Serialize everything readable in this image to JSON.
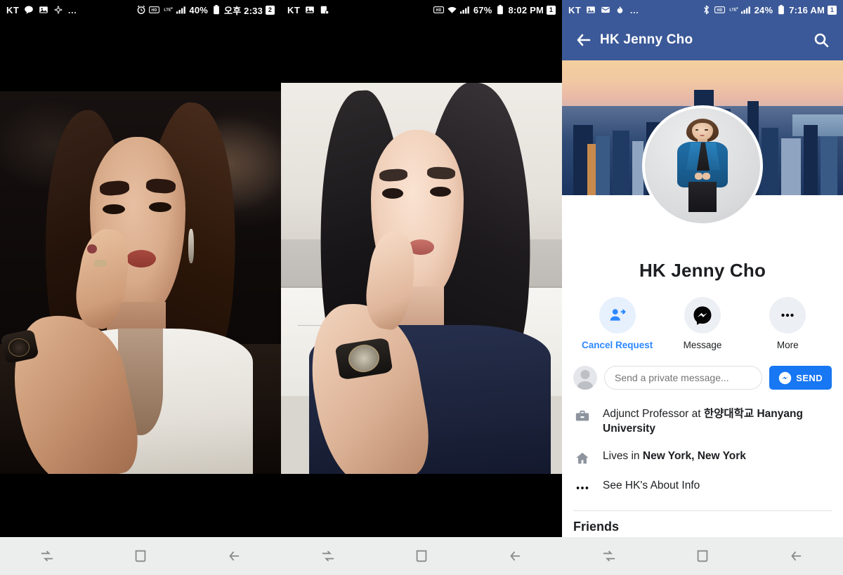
{
  "panels": [
    {
      "statusbar": {
        "carrier": "KT",
        "left_icons": [
          "message-icon",
          "photo-icon",
          "app-icon",
          "overflow-dots"
        ],
        "right_icons": [
          "alarm-icon",
          "hd-icon",
          "lte-icon",
          "signal-bars-icon"
        ],
        "battery": "40%",
        "battery_icon": "battery-icon",
        "time": "오후 2:33",
        "sim": "2"
      },
      "content_name": "photo-viewer-selfie-dark",
      "navbar": {
        "recents": "recents-icon",
        "home": "home-icon",
        "back": "back-icon"
      }
    },
    {
      "statusbar": {
        "carrier": "KT",
        "left_icons": [
          "photo-icon",
          "screenshot-icon"
        ],
        "right_icons": [
          "hd-icon",
          "wifi-icon",
          "signal-bars-icon"
        ],
        "battery": "67%",
        "battery_icon": "battery-icon",
        "time": "8:02 PM",
        "sim": "1"
      },
      "content_name": "photo-viewer-selfie-office",
      "navbar": {
        "recents": "recents-icon",
        "home": "home-icon",
        "back": "back-icon"
      }
    }
  ],
  "facebook": {
    "statusbar": {
      "carrier": "KT",
      "left_icons": [
        "photo-icon",
        "mail-icon",
        "flame-icon",
        "overflow-dots"
      ],
      "right_icons": [
        "bluetooth-icon",
        "hd-icon",
        "lte-icon",
        "signal-bars-icon"
      ],
      "battery": "24%",
      "battery_icon": "battery-icon",
      "time": "7:16 AM",
      "sim": "1"
    },
    "appbar": {
      "back_icon": "arrow-left-icon",
      "title": "HK Jenny Cho",
      "search_icon": "search-icon"
    },
    "cover_photo_name": "cover-photo-new-york-skyline",
    "profile_photo_name": "profile-photo-woman-blue-blazer",
    "profile_name": "HK Jenny Cho",
    "actions": [
      {
        "icon": "person-add-icon",
        "label": "Cancel Request",
        "accent": true
      },
      {
        "icon": "messenger-icon",
        "label": "Message",
        "accent": false
      },
      {
        "icon": "more-dots-icon",
        "label": "More",
        "accent": false
      }
    ],
    "message_composer": {
      "avatar_icon": "default-avatar-icon",
      "placeholder": "Send a private message...",
      "value": "",
      "send_label": "SEND",
      "send_icon": "messenger-icon"
    },
    "info_rows": [
      {
        "icon": "briefcase-icon",
        "prefix": "Adjunct Professor at ",
        "bold": "한양대학교 Hanyang University"
      },
      {
        "icon": "home-house-icon",
        "prefix": "Lives in ",
        "bold": "New York, New York"
      },
      {
        "icon": "ellipsis-icon",
        "prefix": "See HK's About Info",
        "bold": ""
      }
    ],
    "friends_section_title": "Friends",
    "navbar": {
      "recents": "recents-icon",
      "home": "home-icon",
      "back": "back-icon"
    }
  },
  "colors": {
    "facebook_blue": "#3b5998",
    "messenger_blue": "#1877f2",
    "accent_text": "#2d88ff",
    "navbar_bg": "#eceded",
    "statusbar_bg": "#000000"
  }
}
